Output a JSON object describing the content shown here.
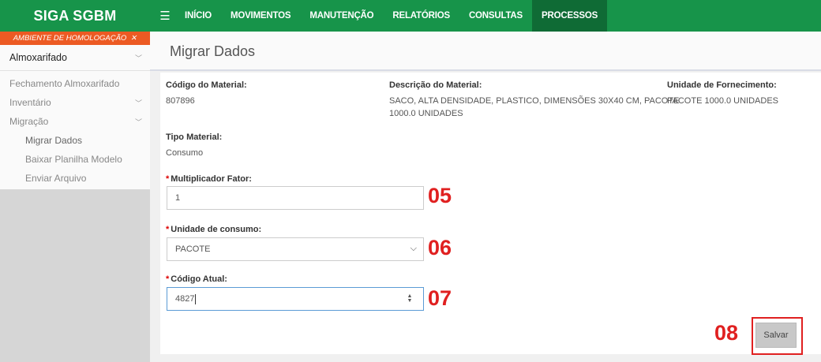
{
  "app": {
    "title": "SIGA SGBM"
  },
  "nav": {
    "menu_icon": "hamburger-icon",
    "items": [
      {
        "label": "INÍCIO",
        "active": false
      },
      {
        "label": "MOVIMENTOS",
        "active": false
      },
      {
        "label": "MANUTENÇÃO",
        "active": false
      },
      {
        "label": "RELATÓRIOS",
        "active": false
      },
      {
        "label": "CONSULTAS",
        "active": false
      },
      {
        "label": "PROCESSOS",
        "active": true
      }
    ]
  },
  "sidebar": {
    "env_banner": "AMBIENTE DE HOMOLOGAÇÃO",
    "env_icon": "tools-icon",
    "root": {
      "label": "Almoxarifado",
      "icon": "chevron-down-icon"
    },
    "items": [
      {
        "label": "Fechamento Almoxarifado"
      },
      {
        "label": "Inventário",
        "icon": "chevron-down-icon"
      },
      {
        "label": "Migração",
        "icon": "chevron-down-icon"
      }
    ],
    "subitems": [
      {
        "label": "Migrar Dados",
        "current": true
      },
      {
        "label": "Baixar Planilha Modelo"
      },
      {
        "label": "Enviar Arquivo"
      }
    ]
  },
  "page": {
    "title": "Migrar Dados"
  },
  "material": {
    "codigo_label": "Código do Material:",
    "codigo_value": "807896",
    "descricao_label": "Descrição do Material:",
    "descricao_line1": "SACO, ALTA DENSIDADE, PLASTICO, DIMENSÕES 30X40 CM, PACOTE",
    "descricao_line2": "1000.0 UNIDADES",
    "unidade_label": "Unidade de Fornecimento:",
    "unidade_value": "PACOTE 1000.0 UNIDADES",
    "tipo_label": "Tipo Material:",
    "tipo_value": "Consumo"
  },
  "form": {
    "required_mark": "*",
    "multiplicador_label": "Multiplicador Fator:",
    "multiplicador_value": "1",
    "unidade_consumo_label": "Unidade de consumo:",
    "unidade_consumo_selected": "PACOTE",
    "codigo_atual_label": "Código Atual:",
    "codigo_atual_value": "4827",
    "save_label": "Salvar"
  },
  "annotations": {
    "step_05": "05",
    "step_06": "06",
    "step_07": "07",
    "step_08": "08",
    "color": "#e02020"
  },
  "colors": {
    "topbar": "#17944a",
    "topbar_active": "#0f6b35",
    "env_banner": "#ec5a23",
    "focus_border": "#5b9bd5"
  }
}
